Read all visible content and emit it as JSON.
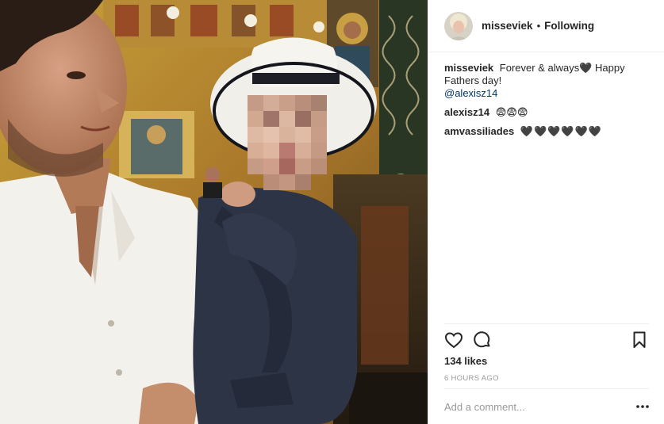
{
  "colors": {
    "text": "#262626",
    "muted": "#999999",
    "link": "#003569",
    "divider": "#efefef"
  },
  "header": {
    "username": "misseviek",
    "separator": "•",
    "follow_status": "Following"
  },
  "comments": [
    {
      "user": "misseviek",
      "text": "Forever & always🖤 Happy Fathers day!",
      "mention": "@alexisz14"
    },
    {
      "user": "alexisz14",
      "text": "😨😨😨"
    },
    {
      "user": "amvassiliades",
      "text": "🖤🖤🖤🖤🖤🖤"
    }
  ],
  "actions": {
    "like_icon": "heart-outline-icon",
    "comment_icon": "speech-bubble-icon",
    "save_icon": "bookmark-icon"
  },
  "likes": "134 likes",
  "timestamp": "6 HOURS AGO",
  "add_comment": {
    "placeholder": "Add a comment..."
  },
  "more_icon": "ellipsis-icon"
}
